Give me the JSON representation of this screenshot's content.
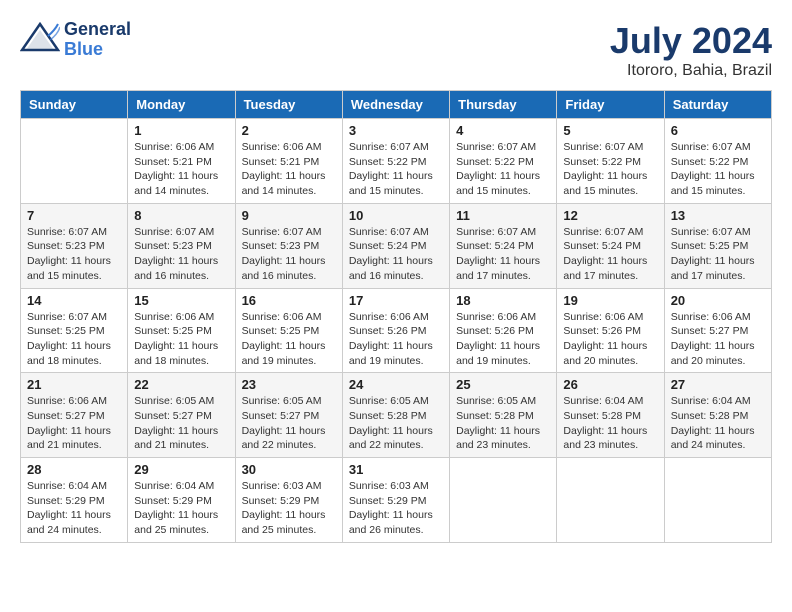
{
  "header": {
    "logo_general": "General",
    "logo_blue": "Blue",
    "title": "July 2024",
    "subtitle": "Itororo, Bahia, Brazil"
  },
  "calendar": {
    "days_of_week": [
      "Sunday",
      "Monday",
      "Tuesday",
      "Wednesday",
      "Thursday",
      "Friday",
      "Saturday"
    ],
    "weeks": [
      [
        {
          "num": "",
          "sunrise": "",
          "sunset": "",
          "daylight": ""
        },
        {
          "num": "1",
          "sunrise": "Sunrise: 6:06 AM",
          "sunset": "Sunset: 5:21 PM",
          "daylight": "Daylight: 11 hours and 14 minutes."
        },
        {
          "num": "2",
          "sunrise": "Sunrise: 6:06 AM",
          "sunset": "Sunset: 5:21 PM",
          "daylight": "Daylight: 11 hours and 14 minutes."
        },
        {
          "num": "3",
          "sunrise": "Sunrise: 6:07 AM",
          "sunset": "Sunset: 5:22 PM",
          "daylight": "Daylight: 11 hours and 15 minutes."
        },
        {
          "num": "4",
          "sunrise": "Sunrise: 6:07 AM",
          "sunset": "Sunset: 5:22 PM",
          "daylight": "Daylight: 11 hours and 15 minutes."
        },
        {
          "num": "5",
          "sunrise": "Sunrise: 6:07 AM",
          "sunset": "Sunset: 5:22 PM",
          "daylight": "Daylight: 11 hours and 15 minutes."
        },
        {
          "num": "6",
          "sunrise": "Sunrise: 6:07 AM",
          "sunset": "Sunset: 5:22 PM",
          "daylight": "Daylight: 11 hours and 15 minutes."
        }
      ],
      [
        {
          "num": "7",
          "sunrise": "Sunrise: 6:07 AM",
          "sunset": "Sunset: 5:23 PM",
          "daylight": "Daylight: 11 hours and 15 minutes."
        },
        {
          "num": "8",
          "sunrise": "Sunrise: 6:07 AM",
          "sunset": "Sunset: 5:23 PM",
          "daylight": "Daylight: 11 hours and 16 minutes."
        },
        {
          "num": "9",
          "sunrise": "Sunrise: 6:07 AM",
          "sunset": "Sunset: 5:23 PM",
          "daylight": "Daylight: 11 hours and 16 minutes."
        },
        {
          "num": "10",
          "sunrise": "Sunrise: 6:07 AM",
          "sunset": "Sunset: 5:24 PM",
          "daylight": "Daylight: 11 hours and 16 minutes."
        },
        {
          "num": "11",
          "sunrise": "Sunrise: 6:07 AM",
          "sunset": "Sunset: 5:24 PM",
          "daylight": "Daylight: 11 hours and 17 minutes."
        },
        {
          "num": "12",
          "sunrise": "Sunrise: 6:07 AM",
          "sunset": "Sunset: 5:24 PM",
          "daylight": "Daylight: 11 hours and 17 minutes."
        },
        {
          "num": "13",
          "sunrise": "Sunrise: 6:07 AM",
          "sunset": "Sunset: 5:25 PM",
          "daylight": "Daylight: 11 hours and 17 minutes."
        }
      ],
      [
        {
          "num": "14",
          "sunrise": "Sunrise: 6:07 AM",
          "sunset": "Sunset: 5:25 PM",
          "daylight": "Daylight: 11 hours and 18 minutes."
        },
        {
          "num": "15",
          "sunrise": "Sunrise: 6:06 AM",
          "sunset": "Sunset: 5:25 PM",
          "daylight": "Daylight: 11 hours and 18 minutes."
        },
        {
          "num": "16",
          "sunrise": "Sunrise: 6:06 AM",
          "sunset": "Sunset: 5:25 PM",
          "daylight": "Daylight: 11 hours and 19 minutes."
        },
        {
          "num": "17",
          "sunrise": "Sunrise: 6:06 AM",
          "sunset": "Sunset: 5:26 PM",
          "daylight": "Daylight: 11 hours and 19 minutes."
        },
        {
          "num": "18",
          "sunrise": "Sunrise: 6:06 AM",
          "sunset": "Sunset: 5:26 PM",
          "daylight": "Daylight: 11 hours and 19 minutes."
        },
        {
          "num": "19",
          "sunrise": "Sunrise: 6:06 AM",
          "sunset": "Sunset: 5:26 PM",
          "daylight": "Daylight: 11 hours and 20 minutes."
        },
        {
          "num": "20",
          "sunrise": "Sunrise: 6:06 AM",
          "sunset": "Sunset: 5:27 PM",
          "daylight": "Daylight: 11 hours and 20 minutes."
        }
      ],
      [
        {
          "num": "21",
          "sunrise": "Sunrise: 6:06 AM",
          "sunset": "Sunset: 5:27 PM",
          "daylight": "Daylight: 11 hours and 21 minutes."
        },
        {
          "num": "22",
          "sunrise": "Sunrise: 6:05 AM",
          "sunset": "Sunset: 5:27 PM",
          "daylight": "Daylight: 11 hours and 21 minutes."
        },
        {
          "num": "23",
          "sunrise": "Sunrise: 6:05 AM",
          "sunset": "Sunset: 5:27 PM",
          "daylight": "Daylight: 11 hours and 22 minutes."
        },
        {
          "num": "24",
          "sunrise": "Sunrise: 6:05 AM",
          "sunset": "Sunset: 5:28 PM",
          "daylight": "Daylight: 11 hours and 22 minutes."
        },
        {
          "num": "25",
          "sunrise": "Sunrise: 6:05 AM",
          "sunset": "Sunset: 5:28 PM",
          "daylight": "Daylight: 11 hours and 23 minutes."
        },
        {
          "num": "26",
          "sunrise": "Sunrise: 6:04 AM",
          "sunset": "Sunset: 5:28 PM",
          "daylight": "Daylight: 11 hours and 23 minutes."
        },
        {
          "num": "27",
          "sunrise": "Sunrise: 6:04 AM",
          "sunset": "Sunset: 5:28 PM",
          "daylight": "Daylight: 11 hours and 24 minutes."
        }
      ],
      [
        {
          "num": "28",
          "sunrise": "Sunrise: 6:04 AM",
          "sunset": "Sunset: 5:29 PM",
          "daylight": "Daylight: 11 hours and 24 minutes."
        },
        {
          "num": "29",
          "sunrise": "Sunrise: 6:04 AM",
          "sunset": "Sunset: 5:29 PM",
          "daylight": "Daylight: 11 hours and 25 minutes."
        },
        {
          "num": "30",
          "sunrise": "Sunrise: 6:03 AM",
          "sunset": "Sunset: 5:29 PM",
          "daylight": "Daylight: 11 hours and 25 minutes."
        },
        {
          "num": "31",
          "sunrise": "Sunrise: 6:03 AM",
          "sunset": "Sunset: 5:29 PM",
          "daylight": "Daylight: 11 hours and 26 minutes."
        },
        {
          "num": "",
          "sunrise": "",
          "sunset": "",
          "daylight": ""
        },
        {
          "num": "",
          "sunrise": "",
          "sunset": "",
          "daylight": ""
        },
        {
          "num": "",
          "sunrise": "",
          "sunset": "",
          "daylight": ""
        }
      ]
    ]
  }
}
